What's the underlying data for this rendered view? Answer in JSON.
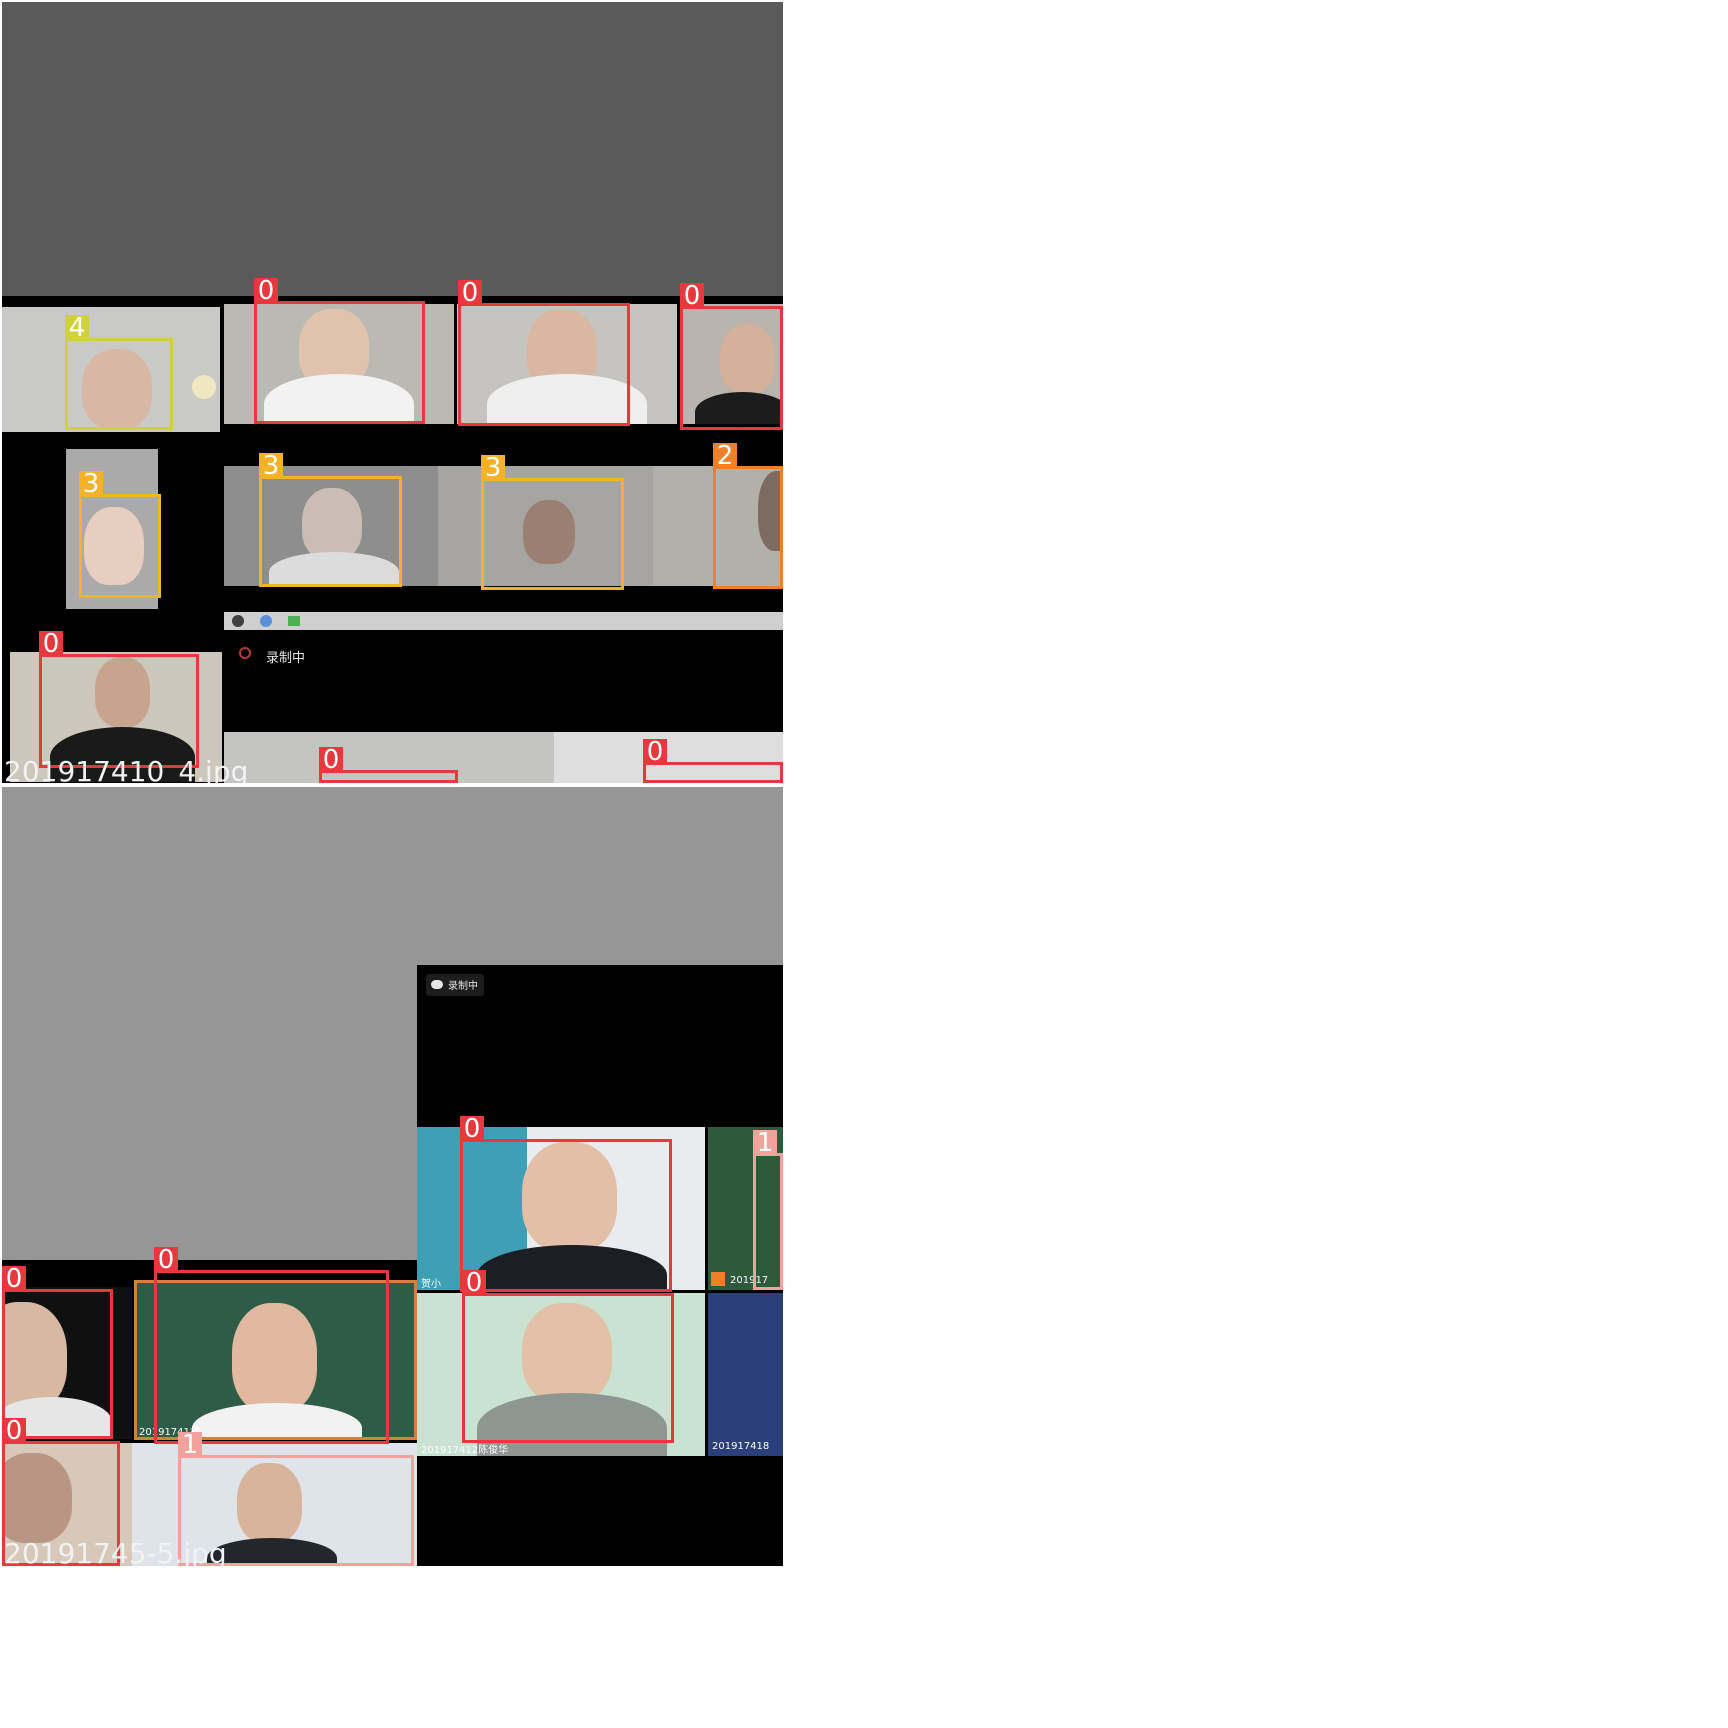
{
  "images": [
    {
      "filename": "201917410_4.jpg",
      "recording_label": "录制中",
      "detections": [
        {
          "label": "4",
          "color": "#cfd23a"
        },
        {
          "label": "0",
          "color": "#e8383d"
        },
        {
          "label": "0",
          "color": "#e8383d"
        },
        {
          "label": "0",
          "color": "#e8383d"
        },
        {
          "label": "3",
          "color": "#f5b128"
        },
        {
          "label": "3",
          "color": "#f5b128"
        },
        {
          "label": "3",
          "color": "#f5b128"
        },
        {
          "label": "2",
          "color": "#f07f2a"
        },
        {
          "label": "0",
          "color": "#e8383d"
        },
        {
          "label": "0",
          "color": "#e8383d"
        },
        {
          "label": "0",
          "color": "#e8383d"
        }
      ]
    },
    {
      "filename": "20191745-5.jpg",
      "recording_label": "录制中",
      "participant_labels": [
        "贺小",
        "201917",
        "20191741林",
        "201917412陈俊华",
        "201917418",
        "20191741"
      ],
      "detections": [
        {
          "label": "0",
          "color": "#e8383d"
        },
        {
          "label": "1",
          "color": "#f2a29a"
        },
        {
          "label": "0",
          "color": "#e8383d"
        },
        {
          "label": "0",
          "color": "#e8383d"
        },
        {
          "label": "0",
          "color": "#e8383d"
        },
        {
          "label": "0",
          "color": "#e8383d"
        },
        {
          "label": "1",
          "color": "#f2a29a"
        }
      ]
    }
  ]
}
